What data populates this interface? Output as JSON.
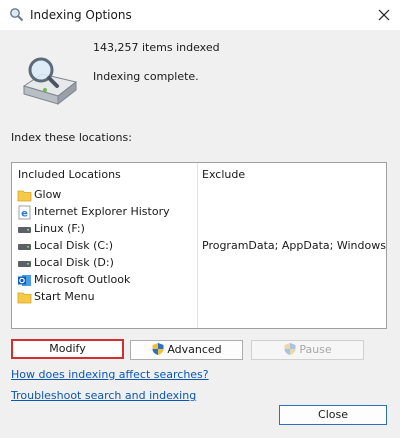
{
  "window": {
    "title": "Indexing Options"
  },
  "summary": {
    "items_indexed": "143,257 items indexed",
    "status": "Indexing complete."
  },
  "locations": {
    "heading": "Index these locations:",
    "columns": {
      "included": "Included Locations",
      "exclude": "Exclude"
    },
    "rows": [
      {
        "name": "Glow",
        "exclude": "",
        "icon": "folder-icon"
      },
      {
        "name": "Internet Explorer History",
        "exclude": "",
        "icon": "ie-history-icon"
      },
      {
        "name": "Linux (F:)",
        "exclude": "",
        "icon": "drive-icon"
      },
      {
        "name": "Local Disk (C:)",
        "exclude": "ProgramData; AppData; Windows",
        "icon": "drive-icon"
      },
      {
        "name": "Local Disk (D:)",
        "exclude": "",
        "icon": "drive-icon"
      },
      {
        "name": "Microsoft Outlook",
        "exclude": "",
        "icon": "outlook-icon"
      },
      {
        "name": "Start Menu",
        "exclude": "",
        "icon": "folder-icon"
      }
    ]
  },
  "buttons": {
    "modify": "Modify",
    "advanced": "Advanced",
    "pause": "Pause",
    "close": "Close"
  },
  "links": {
    "how_indexing": "How does indexing affect searches?",
    "troubleshoot": "Troubleshoot search and indexing"
  },
  "colors": {
    "link": "#0b57b5",
    "highlight_border": "#d32f2f",
    "folder": "#f7c948"
  }
}
